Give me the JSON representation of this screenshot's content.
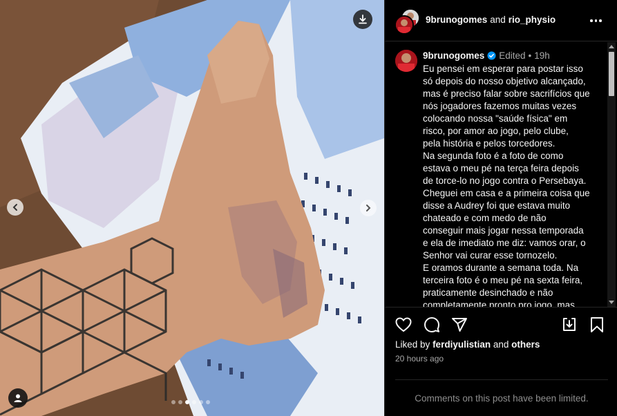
{
  "header": {
    "user1": "9brunogomes",
    "and_text": "and",
    "user2": "rio_physio"
  },
  "caption": {
    "username": "9brunogomes",
    "edited": "Edited",
    "separator": "•",
    "age": "19h",
    "lines": [
      "Eu pensei em esperar para postar isso",
      "só depois do nosso objetivo alcançado,",
      "mas é preciso falar sobre sacrifícios que",
      "nós jogadores fazemos muitas vezes",
      "colocando nossa \"saúde física\" em",
      "risco, por amor ao jogo, pelo clube,",
      "pela história e pelos torcedores.",
      "Na segunda foto é a foto de como",
      "estava o meu pé na terça feira depois",
      "de torce-lo no jogo contra o Persebaya.",
      "Cheguei em casa e a primeira coisa que",
      "disse a Audrey foi que estava muito",
      "chateado e com medo de não",
      "conseguir mais jogar nessa temporada",
      "e ela de imediato me diz: vamos orar, o",
      "Senhor vai curar esse tornozelo.",
      "E oramos durante a semana toda. Na",
      "terceira foto é o meu pé na sexta feira,",
      "praticamente desinchado e não",
      "completamente pronto pro jogo, mas"
    ]
  },
  "likes": {
    "prefix": "Liked by",
    "user": "ferdiyulistian",
    "and_text": "and",
    "others": "others"
  },
  "timestamp": "20 hours ago",
  "comments_limited": "Comments on this post have been limited.",
  "carousel": {
    "total": 6,
    "active_index": 2
  },
  "colors": {
    "background": "#000000",
    "verified": "#0095f6",
    "club_red": "#b0181f"
  }
}
